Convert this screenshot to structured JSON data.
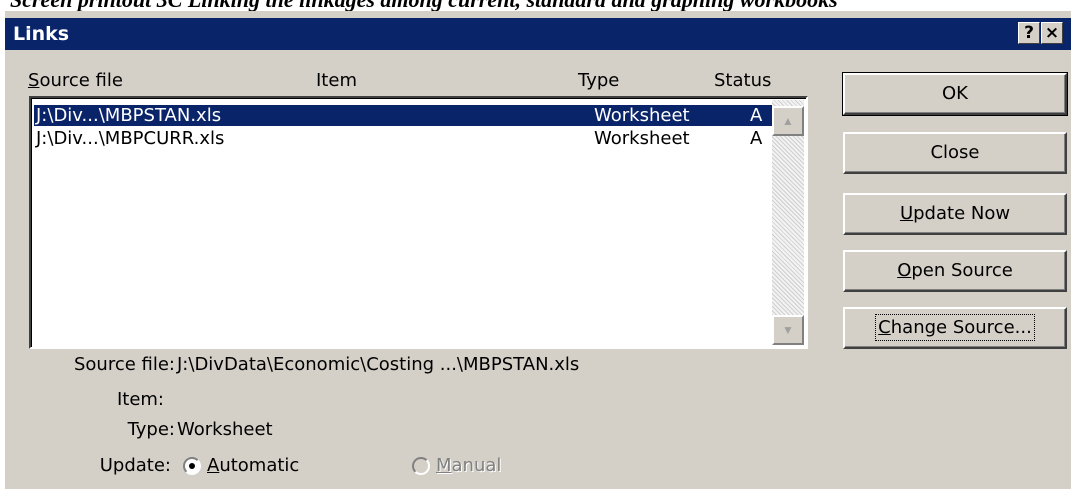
{
  "document": {
    "caption": "Screen printout 3C   Linking the linkages among current, standard and graphing workbooks"
  },
  "window": {
    "title": "Links",
    "help_button": "?",
    "close_button": "×"
  },
  "list": {
    "columns": {
      "source_file_prefix": "S",
      "source_file_rest": "ource file",
      "item": "Item",
      "type": "Type",
      "status": "Status"
    },
    "rows": [
      {
        "source": "J:\\Div...\\MBPSTAN.xls",
        "item": "",
        "type": "Worksheet",
        "status": "A",
        "selected": true
      },
      {
        "source": "J:\\Div...\\MBPCURR.xls",
        "item": "",
        "type": "Worksheet",
        "status": "A",
        "selected": false
      }
    ]
  },
  "buttons": {
    "ok": "OK",
    "close": "Close",
    "update_now_prefix": "U",
    "update_now_rest": "pdate Now",
    "open_source_prefix": "O",
    "open_source_rest": "pen Source",
    "change_source_prefix": "C",
    "change_source_rest": "hange Source..."
  },
  "details": {
    "source_file_label": "Source file:",
    "source_file_value": "J:\\DivData\\Economic\\Costing ...\\MBPSTAN.xls",
    "item_label": "Item:",
    "item_value": "",
    "type_label": "Type:",
    "type_value": "Worksheet",
    "update_label": "Update:",
    "automatic_prefix": "A",
    "automatic_rest": "utomatic",
    "manual_prefix": "M",
    "manual_rest": "anual",
    "update_mode": "automatic"
  },
  "colors": {
    "title_bar": "#0a246a",
    "dialog_face": "#d4d0c8",
    "selection": "#0a246a"
  }
}
